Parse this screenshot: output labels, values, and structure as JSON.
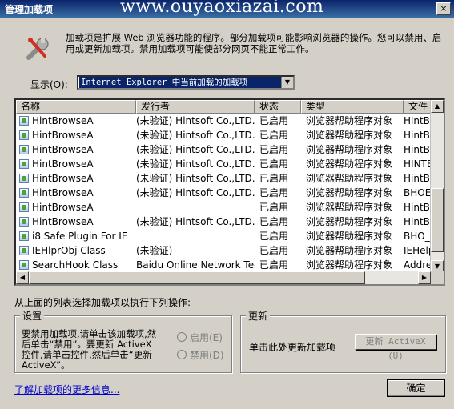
{
  "window": {
    "title": "管理加载项",
    "watermark": "www.ouyaoxiazai.com",
    "close": "×"
  },
  "intro": "加载项是扩展 Web 浏览器功能的程序。部分加载项可能影响浏览器的操作。您可以禁用、启用或更新加载项。禁用加载项可能使部分网页不能正常工作。",
  "show": {
    "label": "显示(O):",
    "selected": "Internet Explorer 中当前加载的加载项"
  },
  "columns": [
    "名称",
    "发行者",
    "状态",
    "类型",
    "文件"
  ],
  "rows": [
    {
      "name": "HintBrowseA",
      "publisher": "(未验证) Hintsoft Co.,LTD.",
      "status": "已启用",
      "type": "浏览器帮助程序对象",
      "file": "HintBro"
    },
    {
      "name": "HintBrowseA",
      "publisher": "(未验证) Hintsoft Co.,LTD.",
      "status": "已启用",
      "type": "浏览器帮助程序对象",
      "file": "HintBro"
    },
    {
      "name": "HintBrowseA",
      "publisher": "(未验证) Hintsoft Co.,LTD.",
      "status": "已启用",
      "type": "浏览器帮助程序对象",
      "file": "HintBro"
    },
    {
      "name": "HintBrowseA",
      "publisher": "(未验证) Hintsoft Co.,LTD.",
      "status": "已启用",
      "type": "浏览器帮助程序对象",
      "file": "HINTBR"
    },
    {
      "name": "HintBrowseA",
      "publisher": "(未验证) Hintsoft Co.,LTD.",
      "status": "已启用",
      "type": "浏览器帮助程序对象",
      "file": "HintBro"
    },
    {
      "name": "HintBrowseA",
      "publisher": "(未验证) Hintsoft Co.,LTD.",
      "status": "已启用",
      "type": "浏览器帮助程序对象",
      "file": "BHOEx"
    },
    {
      "name": "HintBrowseA",
      "publisher": "",
      "status": "已启用",
      "type": "浏览器帮助程序对象",
      "file": "HintBro"
    },
    {
      "name": "HintBrowseA",
      "publisher": "(未验证) Hintsoft Co.,LTD.",
      "status": "已启用",
      "type": "浏览器帮助程序对象",
      "file": "HintBro"
    },
    {
      "name": "i8 Safe Plugin For IE",
      "publisher": "",
      "status": "已启用",
      "type": "浏览器帮助程序对象",
      "file": "BHO_G"
    },
    {
      "name": "IEHlprObj Class",
      "publisher": "(未验证)",
      "status": "已启用",
      "type": "浏览器帮助程序对象",
      "file": "IEHelpe"
    },
    {
      "name": "SearchHook Class",
      "publisher": "Baidu Online Network Tec...",
      "status": "已启用",
      "type": "浏览器帮助程序对象",
      "file": "Addres"
    }
  ],
  "action_label": "从上面的列表选择加载项以执行下列操作:",
  "settings": {
    "title": "设置",
    "text": "要禁用加载项,请单击该加载项,然后单击“禁用”。要更新 ActiveX 控件,请单击控件,然后单击“更新 ActiveX”。",
    "enable": "启用(E)",
    "disable": "禁用(D)"
  },
  "update": {
    "title": "更新",
    "text": "单击此处更新加载项",
    "button": "更新 ActiveX (U)"
  },
  "more_link": "了解加载项的更多信息...",
  "ok": "确定"
}
